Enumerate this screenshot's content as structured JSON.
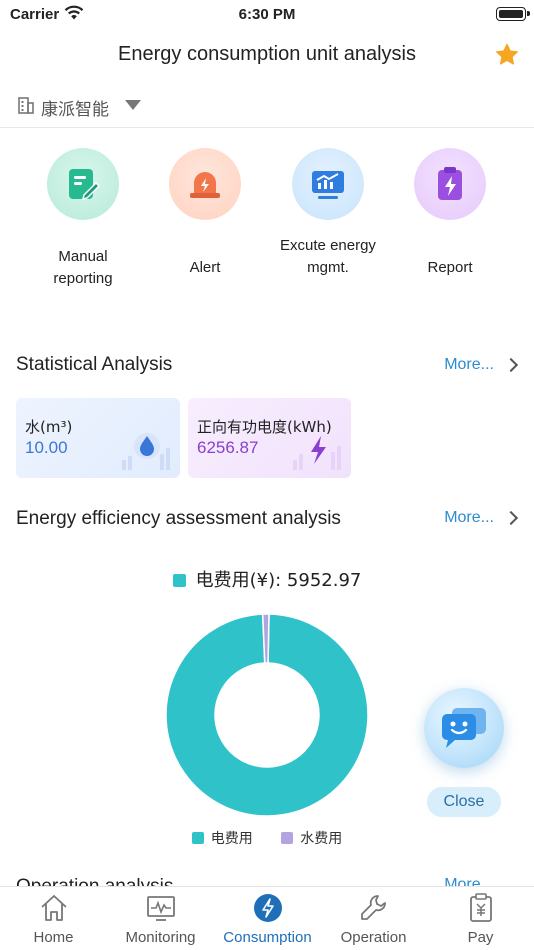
{
  "status_bar": {
    "carrier": "Carrier",
    "time": "6:30 PM"
  },
  "nav": {
    "title": "Energy consumption unit analysis",
    "favorite_icon": "star-icon"
  },
  "org": {
    "name": "康派智能",
    "icon": "building-icon"
  },
  "quick_actions": [
    {
      "label": "Manual reporting",
      "icon": "edit-icon"
    },
    {
      "label": "Alert",
      "icon": "siren-icon"
    },
    {
      "label": "Excute energy mgmt.",
      "icon": "chart-monitor-icon"
    },
    {
      "label": "Report",
      "icon": "clipboard-bolt-icon"
    }
  ],
  "statistical": {
    "title": "Statistical Analysis",
    "more": "More...",
    "cards": [
      {
        "label": "水(m³)",
        "value": "10.00",
        "color": "#3a76d6"
      },
      {
        "label": "正向有功电度(kWh)",
        "value": "6256.87",
        "color": "#8a3fd0"
      }
    ]
  },
  "efficiency": {
    "title": "Energy efficiency assessment analysis",
    "more": "More...",
    "headline": "电费用(¥): 5952.97",
    "legend": [
      {
        "name": "电费用",
        "color": "#2fc3c9"
      },
      {
        "name": "水费用",
        "color": "#b3a4e0"
      }
    ]
  },
  "chart_data": {
    "type": "pie",
    "series": [
      {
        "name": "电费用",
        "value": 5952.97,
        "color": "#2fc3c9"
      },
      {
        "name": "水费用",
        "value": 60,
        "color": "#b3a4e0"
      }
    ]
  },
  "float": {
    "close": "Close"
  },
  "operation": {
    "title": "Operation analysis",
    "more": "More..."
  },
  "tabs": [
    {
      "label": "Home",
      "active": false
    },
    {
      "label": "Monitoring",
      "active": false
    },
    {
      "label": "Consumption",
      "active": true
    },
    {
      "label": "Operation",
      "active": false
    },
    {
      "label": "Pay",
      "active": false
    }
  ]
}
